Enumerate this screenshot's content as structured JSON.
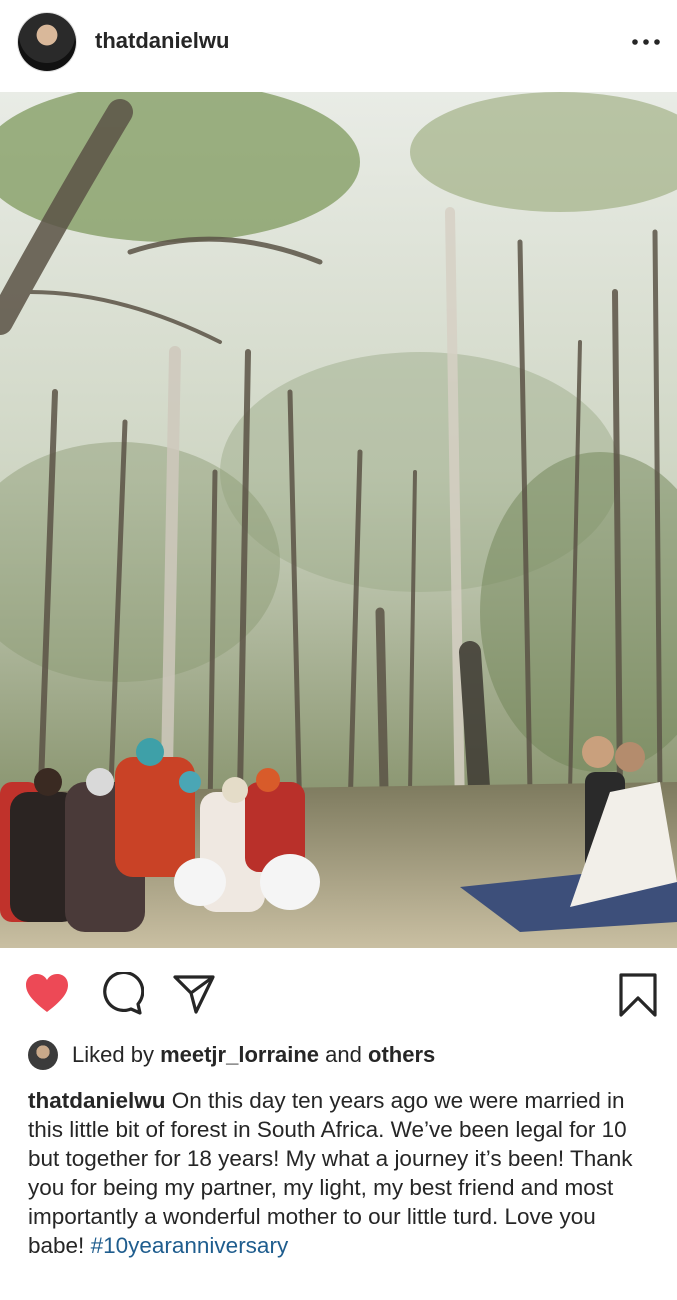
{
  "post": {
    "username": "thatdanielwu",
    "menu_icon": "more-horizontal-icon"
  },
  "actions": {
    "like_icon": "heart-filled-icon",
    "comment_icon": "comment-icon",
    "share_icon": "direct-share-icon",
    "save_icon": "bookmark-icon",
    "like_color": "#ed4956"
  },
  "likes": {
    "prefix": "Liked by",
    "user": "meetjr_lorraine",
    "conjunction": "and",
    "others": "others"
  },
  "caption": {
    "username": "thatdanielwu",
    "text": "On this day ten years ago we were married in this little bit of forest in South Africa. We’ve been legal for 10 but together for 18 years! My what a journey it’s been! Thank you for being my partner, my light, my best friend and most importantly a wonderful mother to our little turd. Love you babe!",
    "hashtag": "#10yearanniversary"
  }
}
